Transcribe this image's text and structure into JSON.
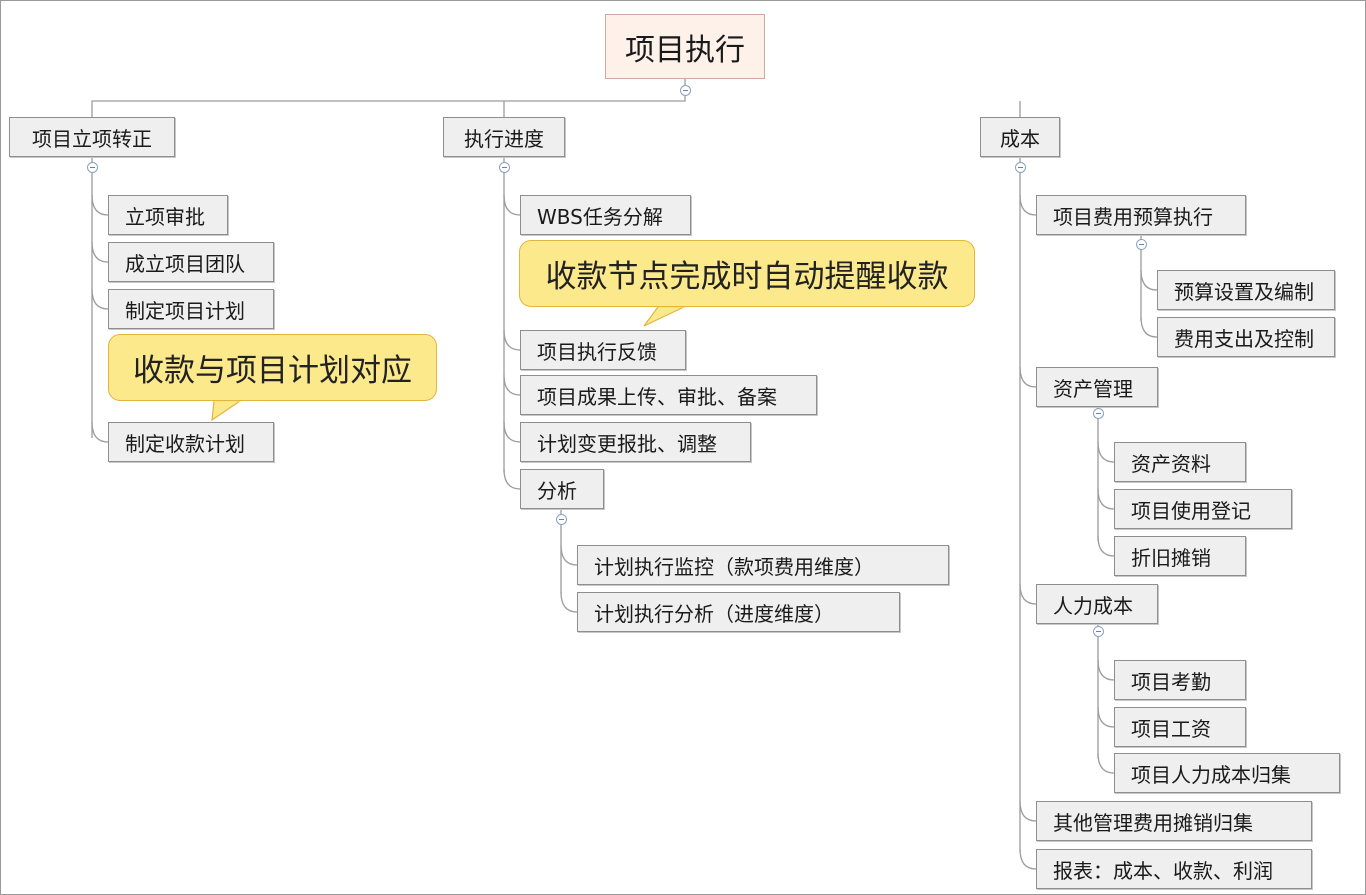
{
  "root": {
    "label": "项目执行"
  },
  "branches": {
    "initiation": {
      "label": "项目立项转正",
      "items": [
        "立项审批",
        "成立项目团队",
        "制定项目计划",
        "制定收款计划"
      ]
    },
    "progress": {
      "label": "执行进度",
      "items": [
        "WBS任务分解",
        "项目执行反馈",
        "项目成果上传、审批、备案",
        "计划变更报批、调整"
      ],
      "analysis": {
        "label": "分析",
        "items": [
          "计划执行监控（款项费用维度）",
          "计划执行分析（进度维度）"
        ]
      }
    },
    "cost": {
      "label": "成本",
      "budget": {
        "label": "项目费用预算执行",
        "items": [
          "预算设置及编制",
          "费用支出及控制"
        ]
      },
      "assets": {
        "label": "资产管理",
        "items": [
          "资产资料",
          "项目使用登记",
          "折旧摊销"
        ]
      },
      "hr": {
        "label": "人力成本",
        "items": [
          "项目考勤",
          "项目工资",
          "项目人力成本归集"
        ]
      },
      "other": "其他管理费用摊销归集",
      "report": "报表：成本、收款、利润"
    }
  },
  "callouts": {
    "payment_plan": "收款与项目计划对应",
    "auto_reminder": "收款节点完成时自动提醒收款"
  }
}
